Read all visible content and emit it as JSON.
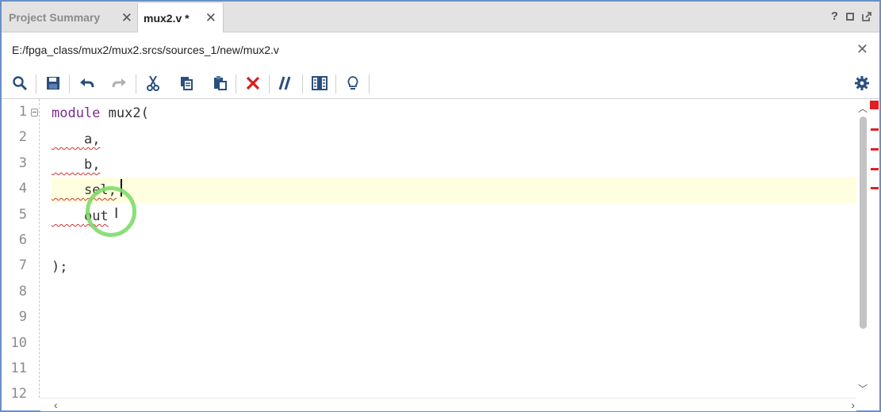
{
  "tabs": [
    {
      "label": "Project Summary",
      "active": false
    },
    {
      "label": "mux2.v *",
      "active": true
    }
  ],
  "window_controls": {
    "help": "?"
  },
  "path": "E:/fpga_class/mux2/mux2.srcs/sources_1/new/mux2.v",
  "toolbar": {
    "icons": [
      "search-icon",
      "save-icon",
      "undo-icon",
      "redo-icon",
      "cut-icon",
      "copy-icon",
      "paste-icon",
      "delete-icon",
      "comment-icon",
      "column-icon",
      "lightbulb-icon",
      "settings-icon"
    ]
  },
  "editor": {
    "line_numbers": [
      "1",
      "2",
      "3",
      "4",
      "5",
      "6",
      "7",
      "8",
      "9",
      "10",
      "11",
      "12"
    ],
    "lines": [
      {
        "kw": "module",
        "rest": " mux2("
      },
      {
        "indent": "    ",
        "text": "a,"
      },
      {
        "indent": "    ",
        "text": "b,"
      },
      {
        "indent": "    ",
        "text": "sel,"
      },
      {
        "indent": "    ",
        "text": "out"
      },
      {
        "indent": "",
        "text": ""
      },
      {
        "indent": "",
        "text": ");"
      }
    ],
    "current_line": 4
  },
  "colors": {
    "accent": "#6b8fc8",
    "keyword": "#7b2c8f",
    "error": "#e02020",
    "current_line": "#ffffe0",
    "click_ring": "#7edc6a"
  }
}
